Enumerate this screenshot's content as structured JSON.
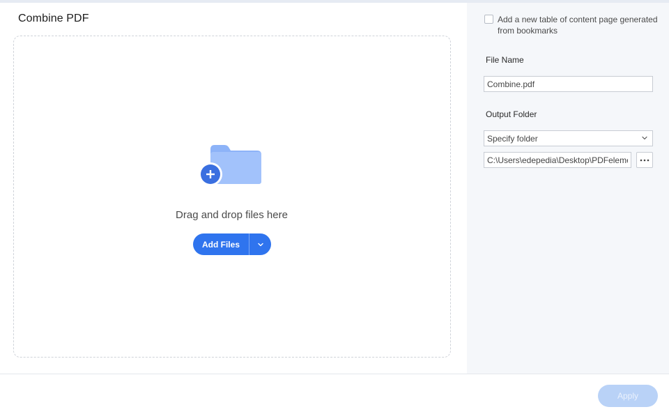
{
  "header": {
    "title": "Combine PDF"
  },
  "dropzone": {
    "message": "Drag and drop files here",
    "add_button_label": "Add Files"
  },
  "options": {
    "toc_label": "Add a new table of content page generated from bookmarks",
    "toc_checked": false
  },
  "file_name": {
    "label": "File Name",
    "value": "Combine.pdf"
  },
  "output_folder": {
    "label": "Output Folder",
    "selected": "Specify folder",
    "path": "C:\\Users\\edepedia\\Desktop\\PDFelement"
  },
  "footer": {
    "apply_label": "Apply"
  },
  "colors": {
    "accent": "#2f74ee",
    "apply_disabled": "#b9d2f7",
    "folder_light": "#8db3f8",
    "panel_bg": "#f5f7fa"
  }
}
